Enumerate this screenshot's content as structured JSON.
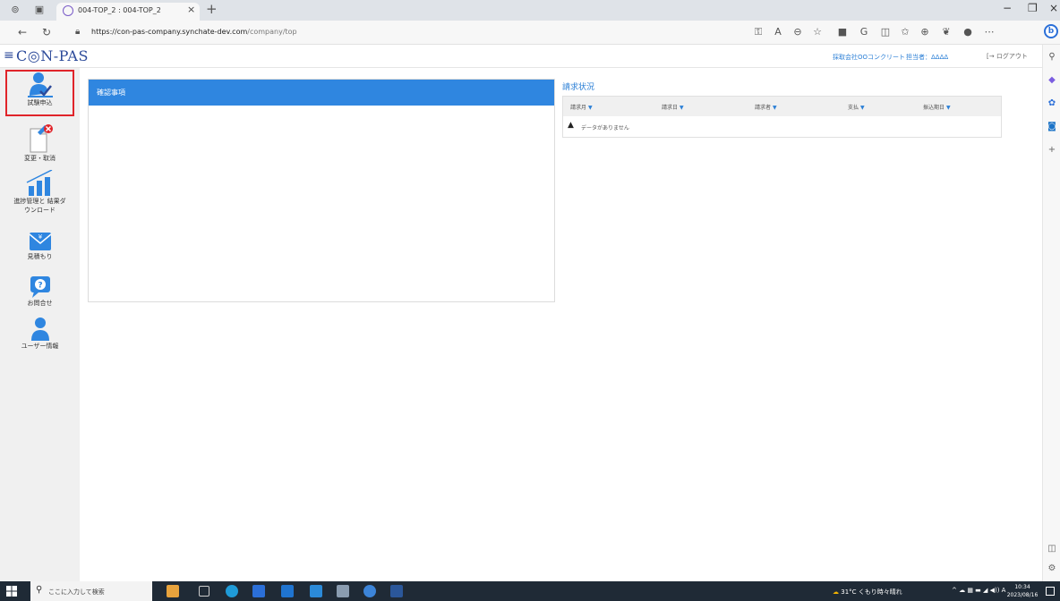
{
  "browser": {
    "tab_title": "004-TOP_2 : 004-TOP_2",
    "url_host": "https://con-pas-company.synchate-dev.com",
    "url_path": "/company/top"
  },
  "app": {
    "logo": "C◎N-PAS",
    "company": "採取会社OOコンクリート",
    "person": "担当者：ΔΔΔΔ",
    "logout": "ログアウト"
  },
  "nav": {
    "items": [
      {
        "label": "試験申込",
        "icon": "person-check-icon",
        "selected": true
      },
      {
        "label": "変更・取消",
        "icon": "document-edit-cancel-icon"
      },
      {
        "label": "進捗管理と 結果ダ\nウンロード",
        "icon": "bar-chart-icon"
      },
      {
        "label": "見積もり",
        "icon": "envelope-yen-icon"
      },
      {
        "label": "お問合せ",
        "icon": "question-bubble-icon"
      },
      {
        "label": "ユーザー情報",
        "icon": "user-icon"
      }
    ]
  },
  "confirm": {
    "title": "確認事項"
  },
  "billing": {
    "title": "請求状況",
    "columns": [
      "請求月",
      "請求日",
      "請求者",
      "支払",
      "振込期日"
    ],
    "empty_message": "データがありません"
  },
  "taskbar": {
    "search_placeholder": "ここに入力して検索",
    "weather": "31°C くもり時々晴れ",
    "time": "10:34",
    "date": "2023/08/16"
  },
  "colors": {
    "accent": "#2f86e0",
    "highlight": "#e0242a",
    "brand": "#2c4a9a"
  }
}
